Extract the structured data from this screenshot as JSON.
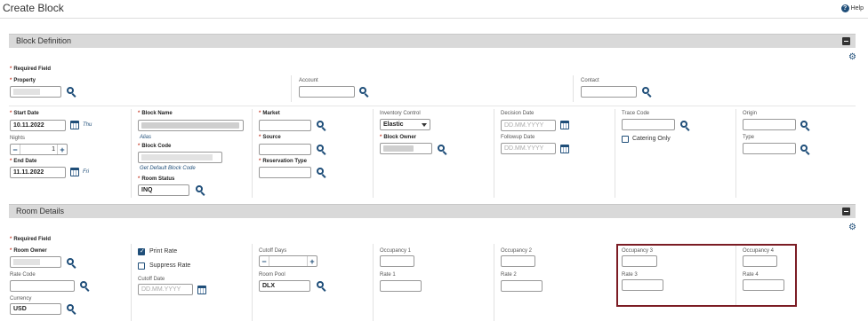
{
  "page": {
    "title": "Create Block",
    "help_label": "Help"
  },
  "block_definition": {
    "section_label": "Block Definition",
    "required_field": "Required Field",
    "property_label": "Property",
    "account_label": "Account",
    "contact_label": "Contact",
    "start_date_label": "Start Date",
    "start_date_value": "10.11.2022",
    "start_day": "Thu",
    "nights_label": "Nights",
    "nights_value": "1",
    "end_date_label": "End Date",
    "end_date_value": "11.11.2022",
    "end_day": "Fri",
    "block_name_label": "Block Name",
    "aliases_link": "Alias",
    "block_code_label": "Block Code",
    "get_default_link": "Get Default Block Code",
    "room_status_label": "Room Status",
    "room_status_value": "INQ",
    "market_label": "Market",
    "source_label": "Source",
    "reservation_type_label": "Reservation Type",
    "inventory_control_label": "Inventory Control",
    "inventory_control_value": "Elastic",
    "block_owner_label": "Block Owner",
    "decision_date_label": "Decision Date",
    "decision_date_placeholder": "DD.MM.YYYY",
    "followup_date_label": "Followup Date",
    "followup_date_placeholder": "DD.MM.YYYY",
    "trace_code_label": "Trace Code",
    "catering_only_label": "Catering Only",
    "origin_label": "Origin",
    "type_label": "Type"
  },
  "room_details": {
    "section_label": "Room Details",
    "required_field": "Required Field",
    "room_owner_label": "Room Owner",
    "rate_code_label": "Rate Code",
    "currency_label": "Currency",
    "currency_value": "USD",
    "print_rate_label": "Print Rate",
    "suppress_rate_label": "Suppress Rate",
    "cutoff_date_label": "Cutoff Date",
    "cutoff_date_placeholder": "DD.MM.YYYY",
    "cutoff_days_label": "Cutoff Days",
    "room_pool_label": "Room Pool",
    "room_pool_value": "DLX",
    "occupancy1_label": "Occupancy 1",
    "rate1_label": "Rate 1",
    "occupancy2_label": "Occupancy 2",
    "rate2_label": "Rate 2",
    "occupancy3_label": "Occupancy 3",
    "rate3_label": "Rate 3",
    "occupancy4_label": "Occupancy 4",
    "rate4_label": "Rate 4"
  },
  "colors": {
    "accent": "#1f4e79",
    "required": "#c74634",
    "highlight": "#7b1c24",
    "section_bg": "#d9d9d9"
  }
}
